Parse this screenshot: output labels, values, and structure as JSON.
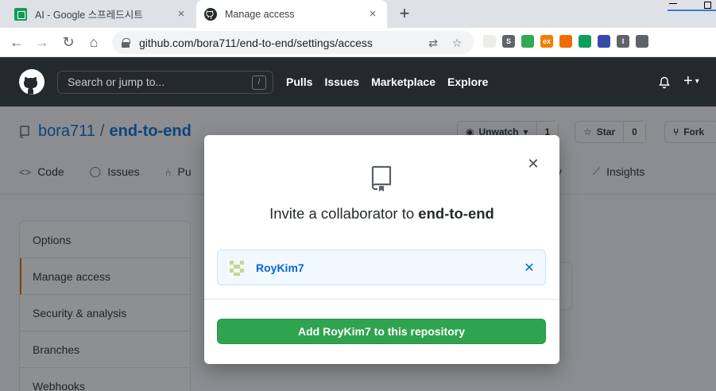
{
  "browser": {
    "tabs": [
      {
        "title": "AI - Google 스프레드시트",
        "close": "×"
      },
      {
        "title": "Manage access",
        "close": "×"
      }
    ],
    "new_tab": "+",
    "url": "github.com/bora711/end-to-end/settings/access",
    "extensions": [
      {
        "label": "",
        "color": "#e8f0e8"
      },
      {
        "label": "S",
        "color": "#5f6368"
      },
      {
        "label": "",
        "color": "#34a853"
      },
      {
        "label": "ex",
        "color": "#f57c00"
      },
      {
        "label": "",
        "color": "#ef6c00"
      },
      {
        "label": "",
        "color": "#0f9d58"
      },
      {
        "label": "",
        "color": "#3949ab"
      },
      {
        "label": "I",
        "color": "#5f6368"
      },
      {
        "label": "",
        "color": "#5f6368"
      }
    ]
  },
  "github_header": {
    "search_placeholder": "Search or jump to...",
    "slash_key": "/",
    "nav": [
      "Pulls",
      "Issues",
      "Marketplace",
      "Explore"
    ],
    "plus": "+"
  },
  "repo": {
    "owner": "bora711",
    "separator": "/",
    "name": "end-to-end",
    "unwatch_label": "Unwatch",
    "unwatch_count": "1",
    "star_label": "Star",
    "star_count": "0",
    "fork_label": "Fork",
    "tabs": [
      "Code",
      "Issues",
      "Pu"
    ],
    "tab_ity": "ty",
    "tab_insights": "Insights"
  },
  "settings_menu": {
    "items": [
      "Options",
      "Manage access",
      "Security & analysis",
      "Branches",
      "Webhooks"
    ],
    "selected": "Manage access"
  },
  "modal": {
    "title_prefix": "Invite a collaborator to",
    "title_repo": "end-to-end",
    "selected_user": "RoyKim7",
    "remove": "✕",
    "close": "✕",
    "button": "Add RoyKim7 to this repository"
  },
  "colors": {
    "accent_green": "#2ea44f",
    "link_blue": "#0366d6",
    "header_dark": "#24292e",
    "selected_marker": "#e36209"
  }
}
